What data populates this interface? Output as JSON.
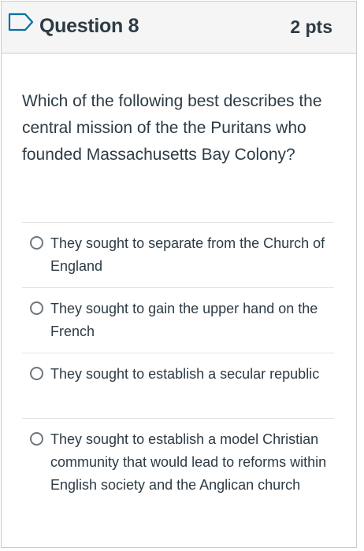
{
  "question": {
    "title": "Question 8",
    "points": "2 pts",
    "text": "Which of the following best describes the central mission of the the Puritans who founded Massachusetts Bay Colony?"
  },
  "answers": [
    {
      "label": "They sought to separate from the Church of England",
      "selected": false
    },
    {
      "label": "They sought to gain the upper hand on the French",
      "selected": false
    },
    {
      "label": "They sought to establish a secular republic",
      "selected": false
    },
    {
      "label": "They sought to establish a model Christian community that would lead to reforms within English society and the Anglican church",
      "selected": false
    }
  ],
  "colors": {
    "text": "#2d3b45",
    "header_bg": "#f5f5f5",
    "border": "#c7cdd1",
    "flag": "#0770a3"
  },
  "icons": {
    "flag": "bookmark-flag-icon",
    "radio": "radio-button-icon"
  }
}
